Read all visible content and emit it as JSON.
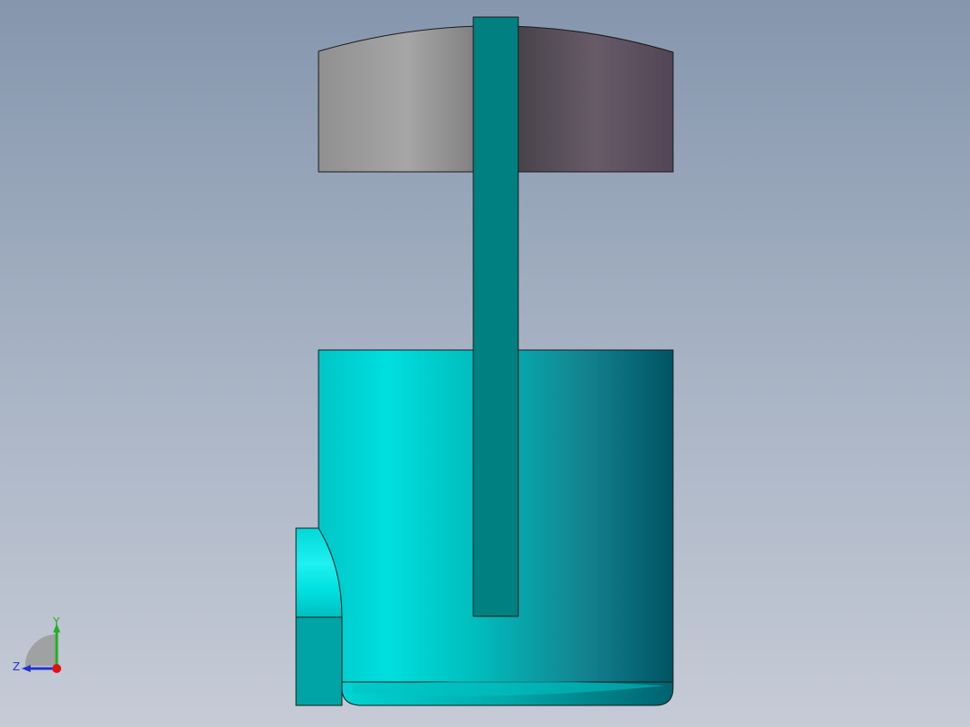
{
  "viewport": {
    "background_top": "#8596ad",
    "background_bottom": "#c6cbd6"
  },
  "model": {
    "cap_color_light": "#a6a6a6",
    "cap_color_dark": "#5b4c5c",
    "body_color_light": "#00d6d6",
    "body_color_dark": "#005c66",
    "rod_color": "#008080",
    "outline_color": "#1a1a1a"
  },
  "triad": {
    "y_label": "Y",
    "z_label": "Z",
    "y_color": "#22b022",
    "z_color": "#2233cc",
    "x_color": "#dd1111",
    "icons": [
      "orientation-triad-icon"
    ]
  }
}
